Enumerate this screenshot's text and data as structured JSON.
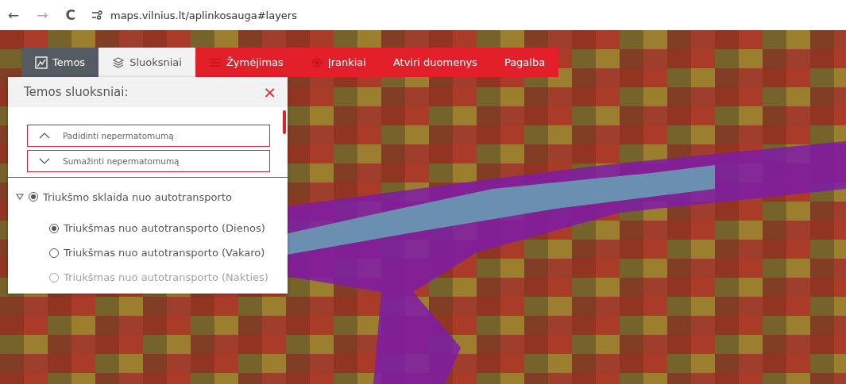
{
  "browser": {
    "back": "←",
    "forward": "→",
    "reload": "C",
    "url": "maps.vilnius.lt/aplinkosauga#layers"
  },
  "tabs": [
    {
      "label": "Temos",
      "kind": "theme",
      "selected": false
    },
    {
      "label": "Sluoksniai",
      "kind": "menu",
      "selected": true
    },
    {
      "label": "Žymėjimas",
      "kind": "menu",
      "selected": false
    },
    {
      "label": "Įrankiai",
      "kind": "menu",
      "selected": false
    },
    {
      "label": "Atviri duomenys",
      "kind": "menu",
      "selected": false
    },
    {
      "label": "Pagalba",
      "kind": "menu",
      "selected": false
    }
  ],
  "panel": {
    "title": "Temos sluoksniai:",
    "close": "×",
    "buttons": [
      {
        "label": "Padidinti nepermatomumą"
      },
      {
        "label": "Sumažinti nepermatomumą"
      }
    ],
    "layers": [
      {
        "label": "Triukšmo sklaida nuo autotransporto",
        "selected": true,
        "expanded": true,
        "children": [
          {
            "label": "Triukšmas nuo autotransporto (Dienos)",
            "selected": true
          },
          {
            "label": "Triukšmas nuo autotransporto (Vakaro)",
            "selected": false
          },
          {
            "label": "Triukšmas nuo autotransporto (Nakties)",
            "selected": false
          }
        ]
      }
    ]
  }
}
